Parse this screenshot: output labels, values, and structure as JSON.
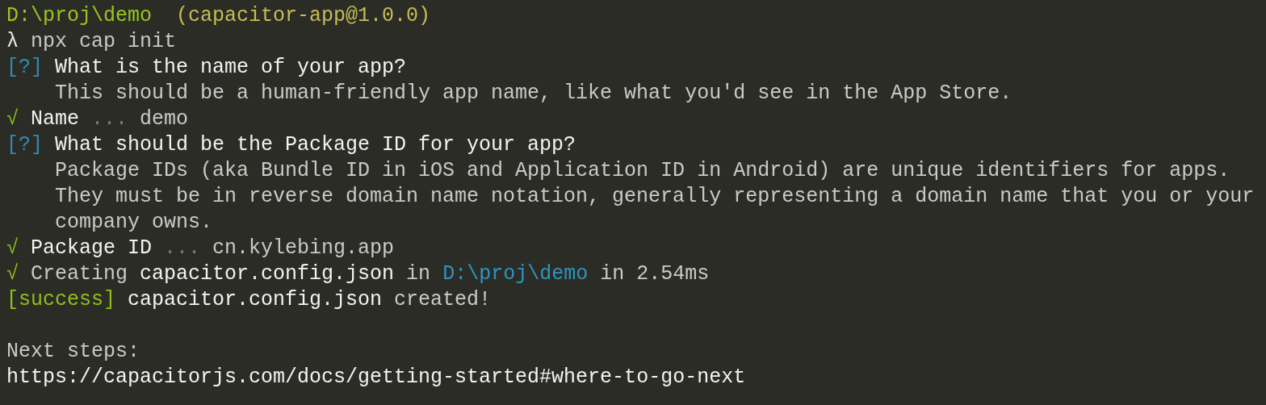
{
  "terminal": {
    "lines": [
      {
        "kind": "text",
        "indented": false,
        "segments": [
          {
            "kind": "path",
            "text": "D:\\proj\\demo"
          },
          {
            "kind": "package",
            "text": " (capacitor-app@1.0.0)"
          }
        ]
      },
      {
        "kind": "text",
        "indented": false,
        "segments": [
          {
            "kind": "prompt",
            "text": "λ"
          },
          {
            "kind": "command",
            "text": "npx cap init"
          }
        ]
      },
      {
        "kind": "text",
        "indented": false,
        "segments": [
          {
            "kind": "question",
            "text": "[?]"
          },
          {
            "kind": "bright",
            "text": "What is the name of your app?"
          }
        ]
      },
      {
        "kind": "text",
        "indented": true,
        "segments": [
          {
            "kind": "plain",
            "text": "This should be a human-friendly app name, like what you'd see in the App Store."
          }
        ]
      },
      {
        "kind": "text",
        "indented": false,
        "segments": [
          {
            "kind": "check",
            "text": "√"
          },
          {
            "kind": "bright",
            "text": "Name"
          },
          {
            "kind": "dim",
            "text": "..."
          },
          {
            "kind": "plain",
            "text": "demo"
          }
        ]
      },
      {
        "kind": "text",
        "indented": false,
        "segments": [
          {
            "kind": "question",
            "text": "[?]"
          },
          {
            "kind": "bright",
            "text": "What should be the Package ID for your app?"
          }
        ]
      },
      {
        "kind": "text",
        "indented": true,
        "segments": [
          {
            "kind": "plain",
            "text": "Package IDs (aka Bundle ID in iOS and Application ID in Android) are unique identifiers for apps."
          }
        ]
      },
      {
        "kind": "text",
        "indented": true,
        "segments": [
          {
            "kind": "plain",
            "text": "They must be in reverse domain name notation, generally representing a domain name that you or your"
          }
        ]
      },
      {
        "kind": "text",
        "indented": true,
        "segments": [
          {
            "kind": "plain",
            "text": "company owns."
          }
        ]
      },
      {
        "kind": "text",
        "indented": false,
        "segments": [
          {
            "kind": "check",
            "text": "√"
          },
          {
            "kind": "bright",
            "text": "Package ID"
          },
          {
            "kind": "dim",
            "text": "..."
          },
          {
            "kind": "plain",
            "text": "cn.kylebing.app"
          }
        ]
      },
      {
        "kind": "text",
        "indented": false,
        "segments": [
          {
            "kind": "check",
            "text": "√"
          },
          {
            "kind": "plain",
            "text": "Creating"
          },
          {
            "kind": "bright",
            "text": "capacitor.config.json"
          },
          {
            "kind": "plain",
            "text": "in"
          },
          {
            "kind": "link",
            "text": "D:\\proj\\demo"
          },
          {
            "kind": "plain",
            "text": "in 2.54ms"
          }
        ]
      },
      {
        "kind": "text",
        "indented": false,
        "segments": [
          {
            "kind": "success",
            "text": "[success]"
          },
          {
            "kind": "bright",
            "text": "capacitor.config.json"
          },
          {
            "kind": "plain",
            "text": "created!"
          }
        ]
      },
      {
        "kind": "blank"
      },
      {
        "kind": "text",
        "indented": false,
        "segments": [
          {
            "kind": "plain",
            "text": "Next steps:"
          }
        ]
      },
      {
        "kind": "text",
        "indented": false,
        "segments": [
          {
            "kind": "bright",
            "text": "https://capacitorjs.com/docs/getting-started#where-to-go-next"
          }
        ]
      }
    ]
  }
}
